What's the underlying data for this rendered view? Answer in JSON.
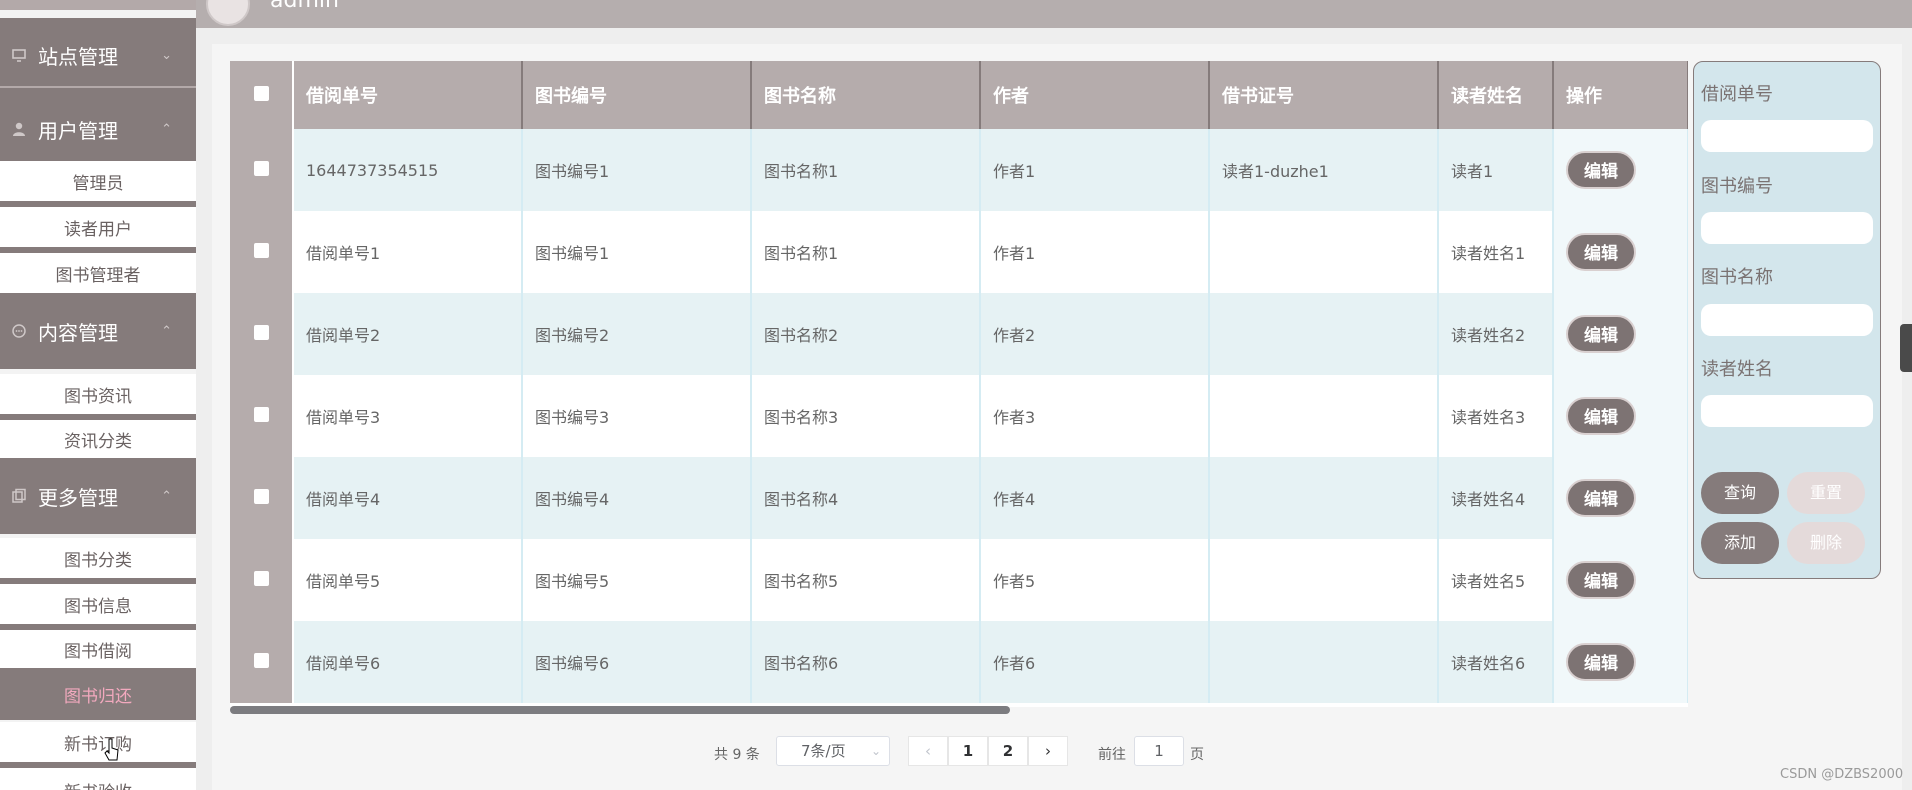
{
  "sidebar": {
    "groups": [
      {
        "label": "站点管理",
        "icon": "monitor-icon"
      },
      {
        "label": "用户管理",
        "icon": "user-icon"
      },
      {
        "label": "内容管理",
        "icon": "chat-icon"
      },
      {
        "label": "更多管理",
        "icon": "copy-icon"
      }
    ],
    "items": {
      "admins": "管理员",
      "readers": "读者用户",
      "book_managers": "图书管理者",
      "book_news": "图书资讯",
      "news_category": "资讯分类",
      "book_category": "图书分类",
      "book_info": "图书信息",
      "book_borrow": "图书借阅",
      "book_return": "图书归还",
      "new_purchase": "新书订购",
      "new_accept": "新书验收"
    }
  },
  "header": {
    "username": "admin"
  },
  "table": {
    "columns": [
      "借阅单号",
      "图书编号",
      "图书名称",
      "作者",
      "借书证号",
      "读者姓名",
      "操作"
    ],
    "rows": [
      {
        "no": "1644737354515",
        "book_code": "图书编号1",
        "book_name": "图书名称1",
        "author": "作者1",
        "card": "读者1-duzhe1",
        "reader": "读者1"
      },
      {
        "no": "借阅单号1",
        "book_code": "图书编号1",
        "book_name": "图书名称1",
        "author": "作者1",
        "card": "",
        "reader": "读者姓名1"
      },
      {
        "no": "借阅单号2",
        "book_code": "图书编号2",
        "book_name": "图书名称2",
        "author": "作者2",
        "card": "",
        "reader": "读者姓名2"
      },
      {
        "no": "借阅单号3",
        "book_code": "图书编号3",
        "book_name": "图书名称3",
        "author": "作者3",
        "card": "",
        "reader": "读者姓名3"
      },
      {
        "no": "借阅单号4",
        "book_code": "图书编号4",
        "book_name": "图书名称4",
        "author": "作者4",
        "card": "",
        "reader": "读者姓名4"
      },
      {
        "no": "借阅单号5",
        "book_code": "图书编号5",
        "book_name": "图书名称5",
        "author": "作者5",
        "card": "",
        "reader": "读者姓名5"
      },
      {
        "no": "借阅单号6",
        "book_code": "图书编号6",
        "book_name": "图书名称6",
        "author": "作者6",
        "card": "",
        "reader": "读者姓名6"
      }
    ],
    "edit_label": "编辑"
  },
  "search": {
    "labels": [
      "借阅单号",
      "图书编号",
      "图书名称",
      "读者姓名"
    ],
    "query_label": "查询",
    "reset_label": "重置",
    "add_label": "添加",
    "delete_label": "删除"
  },
  "pagination": {
    "total": "共 9 条",
    "page_size": "7条/页",
    "pages": [
      "1",
      "2"
    ],
    "goto_prefix": "前往",
    "goto_value": "1",
    "goto_suffix": "页"
  },
  "watermark": "CSDN @DZBS2000",
  "colors": {
    "sidebar_group": "#857b7b",
    "header": "#b5acac",
    "active_item_text": "#f2a9be",
    "row_alt": "#e6f2f4",
    "search_panel": "#d3e6ec"
  }
}
